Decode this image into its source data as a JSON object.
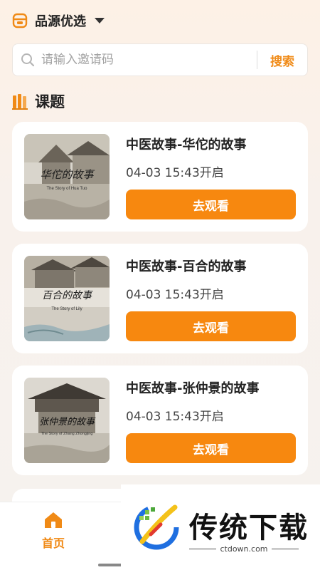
{
  "header": {
    "store_name": "品源优选",
    "icon": "store-icon"
  },
  "search": {
    "placeholder": "请输入邀请码",
    "value": "",
    "button_label": "搜索",
    "icon": "search-icon"
  },
  "section": {
    "title": "课题",
    "icon": "books-icon"
  },
  "courses": [
    {
      "title": "中医故事-华佗的故事",
      "time": "04-03 15:43开启",
      "button_label": "去观看",
      "thumb_caption": "华佗的故事",
      "thumb_subcaption": "The Story of Hua Tuo"
    },
    {
      "title": "中医故事-百合的故事",
      "time": "04-03 15:43开启",
      "button_label": "去观看",
      "thumb_caption": "百合的故事",
      "thumb_subcaption": "The Story of Lily"
    },
    {
      "title": "中医故事-张仲景的故事",
      "time": "04-03 15:43开启",
      "button_label": "去观看",
      "thumb_caption": "张仲景的故事",
      "thumb_subcaption": "The Story of Zhang Zhongjing"
    }
  ],
  "bottom_nav": {
    "home_label": "首页",
    "home_icon": "home-icon"
  },
  "watermark": {
    "text": "传统下载",
    "sub": "ctdown.com"
  },
  "colors": {
    "accent": "#f7880f",
    "accent_text": "#f08a16",
    "card_bg": "#ffffff",
    "page_bg": "#f6f2ef"
  }
}
